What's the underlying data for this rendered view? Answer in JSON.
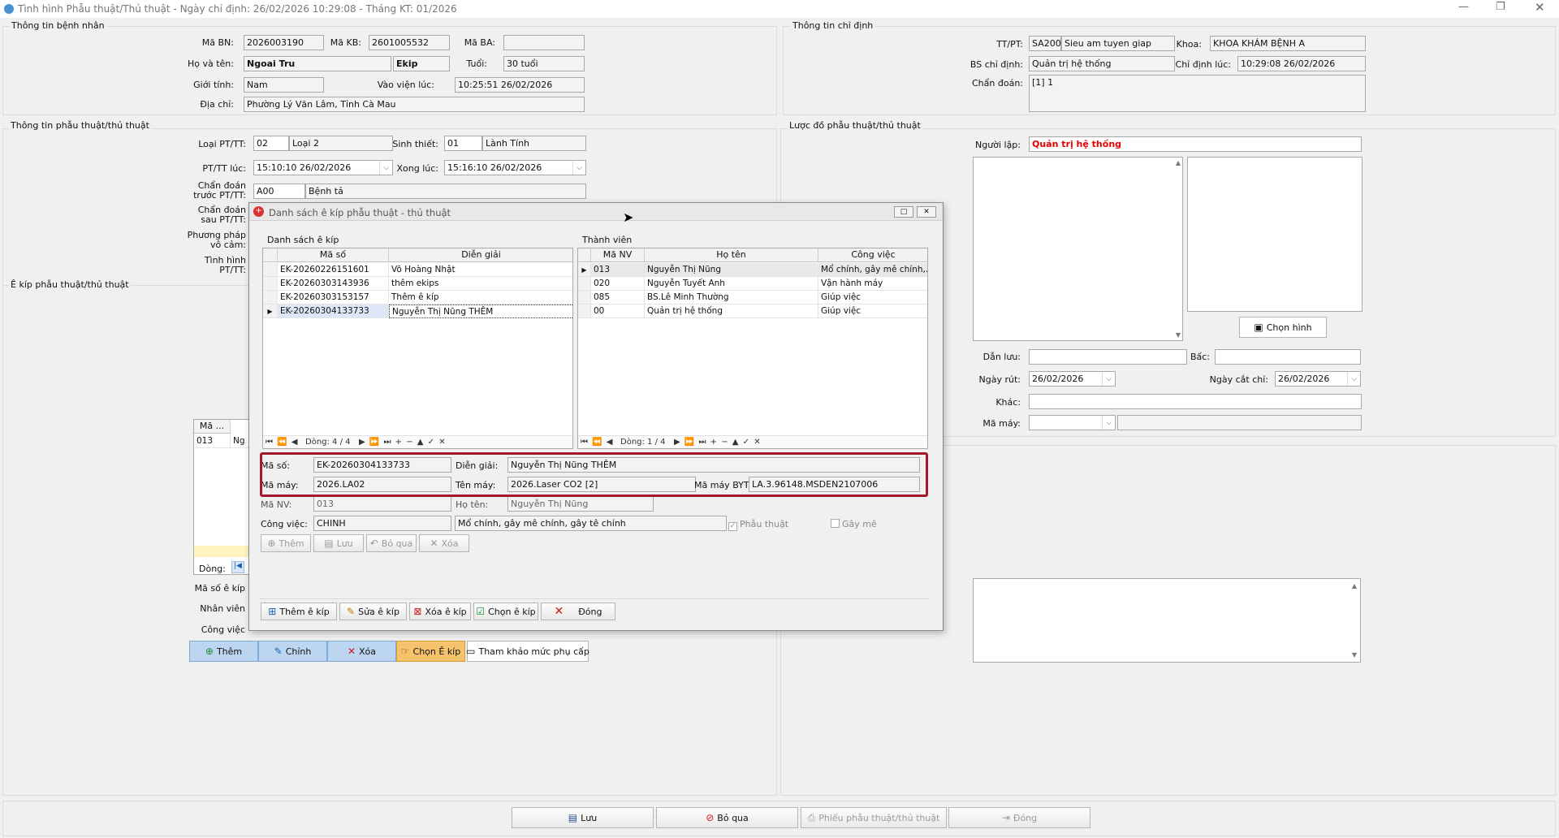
{
  "window": {
    "title": "Tình hình Phẫu thuật/Thủ thuật - Ngày chỉ định: 26/02/2026 10:29:08 - Tháng KT: 01/2026"
  },
  "patient": {
    "section": "Thông tin bệnh nhân",
    "ma_bn_label": "Mã BN:",
    "ma_bn": "2026003190",
    "ma_kb_label": "Mã KB:",
    "ma_kb": "2601005532",
    "ma_ba_label": "Mã BA:",
    "ma_ba": "",
    "ho_ten_label": "Họ và tên:",
    "ho_ten": "Ngoai Tru",
    "ekip": "Ekip",
    "tuoi_label": "Tuổi:",
    "tuoi": "30 tuổi",
    "gioi_tinh_label": "Giới tính:",
    "gioi_tinh": "Nam",
    "vao_vien_label": "Vào viện lúc:",
    "vao_vien": "10:25:51 26/02/2026",
    "dia_chi_label": "Địa chỉ:",
    "dia_chi": "Phường Lý Văn Lâm, Tỉnh Cà Mau"
  },
  "order": {
    "section": "Thông tin chỉ định",
    "ttpt_label": "TT/PT:",
    "ttpt_code": "SA200",
    "ttpt_name": "Sieu am tuyen giap",
    "khoa_label": "Khoa:",
    "khoa": "KHOA KHÁM BỆNH A",
    "bs_label": "BS chỉ định:",
    "bs": "Quản trị hệ thống",
    "chi_dinh_luc_label": "Chỉ định lúc:",
    "chi_dinh_luc": "10:29:08 26/02/2026",
    "chan_doan_label": "Chẩn đoán:",
    "chan_doan": "[1] 1"
  },
  "surgery": {
    "section": "Thông tin phẫu thuật/thủ thuật",
    "loai_label": "Loại PT/TT:",
    "loai_code": "02",
    "loai_name": "Loại 2",
    "sinh_thiet_label": "Sinh thiết:",
    "sinh_thiet_code": "01",
    "sinh_thiet_name": "Lành Tính",
    "pttt_luc_label": "PT/TT lúc:",
    "pttt_luc": "15:10:10 26/02/2026",
    "xong_luc_label": "Xong lúc:",
    "xong_luc": "15:16:10 26/02/2026",
    "cd_truoc_label1": "Chẩn đoán",
    "cd_truoc_label2": "trước PT/TT:",
    "cd_truoc_code": "A00",
    "cd_truoc_name": "Bệnh tả",
    "cd_sau_label1": "Chẩn đoán",
    "cd_sau_label2": "sau PT/TT:",
    "pp_vo_cam_label1": "Phương pháp",
    "pp_vo_cam_label2": "vô cảm:",
    "tinh_hinh_label1": "Tình hình",
    "tinh_hinh_label2": "PT/TT:"
  },
  "ekip_section": {
    "section": "Ê kíp phẫu thuật/thủ thuật",
    "col_ma": "Mã ...",
    "row_ma": "013",
    "row_name": "Ng",
    "dong_label": "Dòng:",
    "ma_so_label": "Mã số ê kíp",
    "nhan_vien_label": "Nhân viên",
    "cong_viec_label": "Công việc",
    "cong_viec_value": "CHINH",
    "cong_viec_desc": "Mổ chính, gây mê chính, gây tê chính",
    "btn_them": "Thêm",
    "btn_chinh": "Chỉnh",
    "btn_xoa": "Xóa",
    "btn_chon": "Chọn Ê kíp",
    "btn_tham_khao": "Tham khảo mức phụ cấp"
  },
  "diagram": {
    "section": "Lược đồ phẫu thuật/thủ thuật",
    "nguoi_lap_label": "Người lập:",
    "nguoi_lap": "Quản trị hệ thống",
    "chon_hinh": "Chọn hình",
    "dan_luu_label": "Dẫn lưu:",
    "bac_label": "Bấc:",
    "ngay_rut_label": "Ngày rút:",
    "ngay_rut": "26/02/2026",
    "ngay_cat_chi_label": "Ngày cắt chỉ:",
    "ngay_cat_chi": "26/02/2026",
    "khac_label": "Khác:",
    "ma_may_label": "Mã máy:"
  },
  "bottom": {
    "luu": "Lưu",
    "bo_qua": "Bỏ qua",
    "phieu": "Phiếu phẫu thuật/thủ thuật",
    "dong": "Đóng"
  },
  "dialog": {
    "title": "Danh sách ê kíp phẫu thuật - thủ thuật",
    "left_title": "Danh sách ê kíp",
    "left_cols": [
      "Mã số",
      "Diễn giải"
    ],
    "left_rows": [
      {
        "ma": "EK-20260226151601",
        "dg": "Võ Hoàng Nhật"
      },
      {
        "ma": "EK-20260303143936",
        "dg": "thêm ekips"
      },
      {
        "ma": "EK-20260303153157",
        "dg": "Thêm ê kíp"
      },
      {
        "ma": "EK-20260304133733",
        "dg": "Nguyễn Thị Nũng THÊM"
      }
    ],
    "left_nav": "Dòng: 4 / 4",
    "right_title": "Thành viên",
    "right_cols": [
      "Mã NV",
      "Họ tên",
      "Công việc"
    ],
    "right_rows": [
      {
        "ma": "013",
        "ten": "Nguyễn Thị Nũng",
        "cv": "Mổ chính, gây mê chính,..."
      },
      {
        "ma": "020",
        "ten": "Nguyễn Tuyết Anh",
        "cv": "Vận hành máy"
      },
      {
        "ma": "085",
        "ten": "BS.Lê Minh Thường",
        "cv": "Giúp việc"
      },
      {
        "ma": "00",
        "ten": "Quản trị hệ thống",
        "cv": "Giúp việc"
      }
    ],
    "right_nav": "Dòng: 1 / 4",
    "ma_so_label": "Mã số:",
    "ma_so": "EK-20260304133733",
    "dien_giai_label": "Diễn giải:",
    "dien_giai": "Nguyễn Thị Nũng THÊM",
    "ma_may_label": "Mã máy:",
    "ma_may": "2026.LA02",
    "ten_may_label": "Tên máy:",
    "ten_may": "2026.Laser CO2 [2]",
    "ma_may_byt_label": "Mã máy BYT:",
    "ma_may_byt": "LA.3.96148.MSDEN2107006",
    "ma_nv_label": "Mã NV:",
    "ma_nv": "013",
    "ho_ten_label": "Họ tên:",
    "ho_ten": "Nguyễn Thị Nũng",
    "cong_viec_label": "Công việc:",
    "cong_viec": "CHINH",
    "cong_viec_desc": "Mổ chính, gây mê chính, gây tê chính",
    "phau_thuat": "Phẫu thuật",
    "gay_me": "Gây mê",
    "btn_them": "Thêm",
    "btn_luu": "Lưu",
    "btn_bo_qua": "Bỏ qua",
    "btn_xoa": "Xóa",
    "btn_them_ekip": "Thêm ê kíp",
    "btn_sua_ekip": "Sửa ê kíp",
    "btn_xoa_ekip": "Xóa  ê kíp",
    "btn_chon_ekip": "Chọn  ê kíp",
    "btn_dong": "Đóng"
  },
  "colors": {
    "highlight_border": "#a3182e",
    "selected_tab": "#f5c36b",
    "blue_button": "#bcd6f2",
    "red_text": "#e60000"
  }
}
